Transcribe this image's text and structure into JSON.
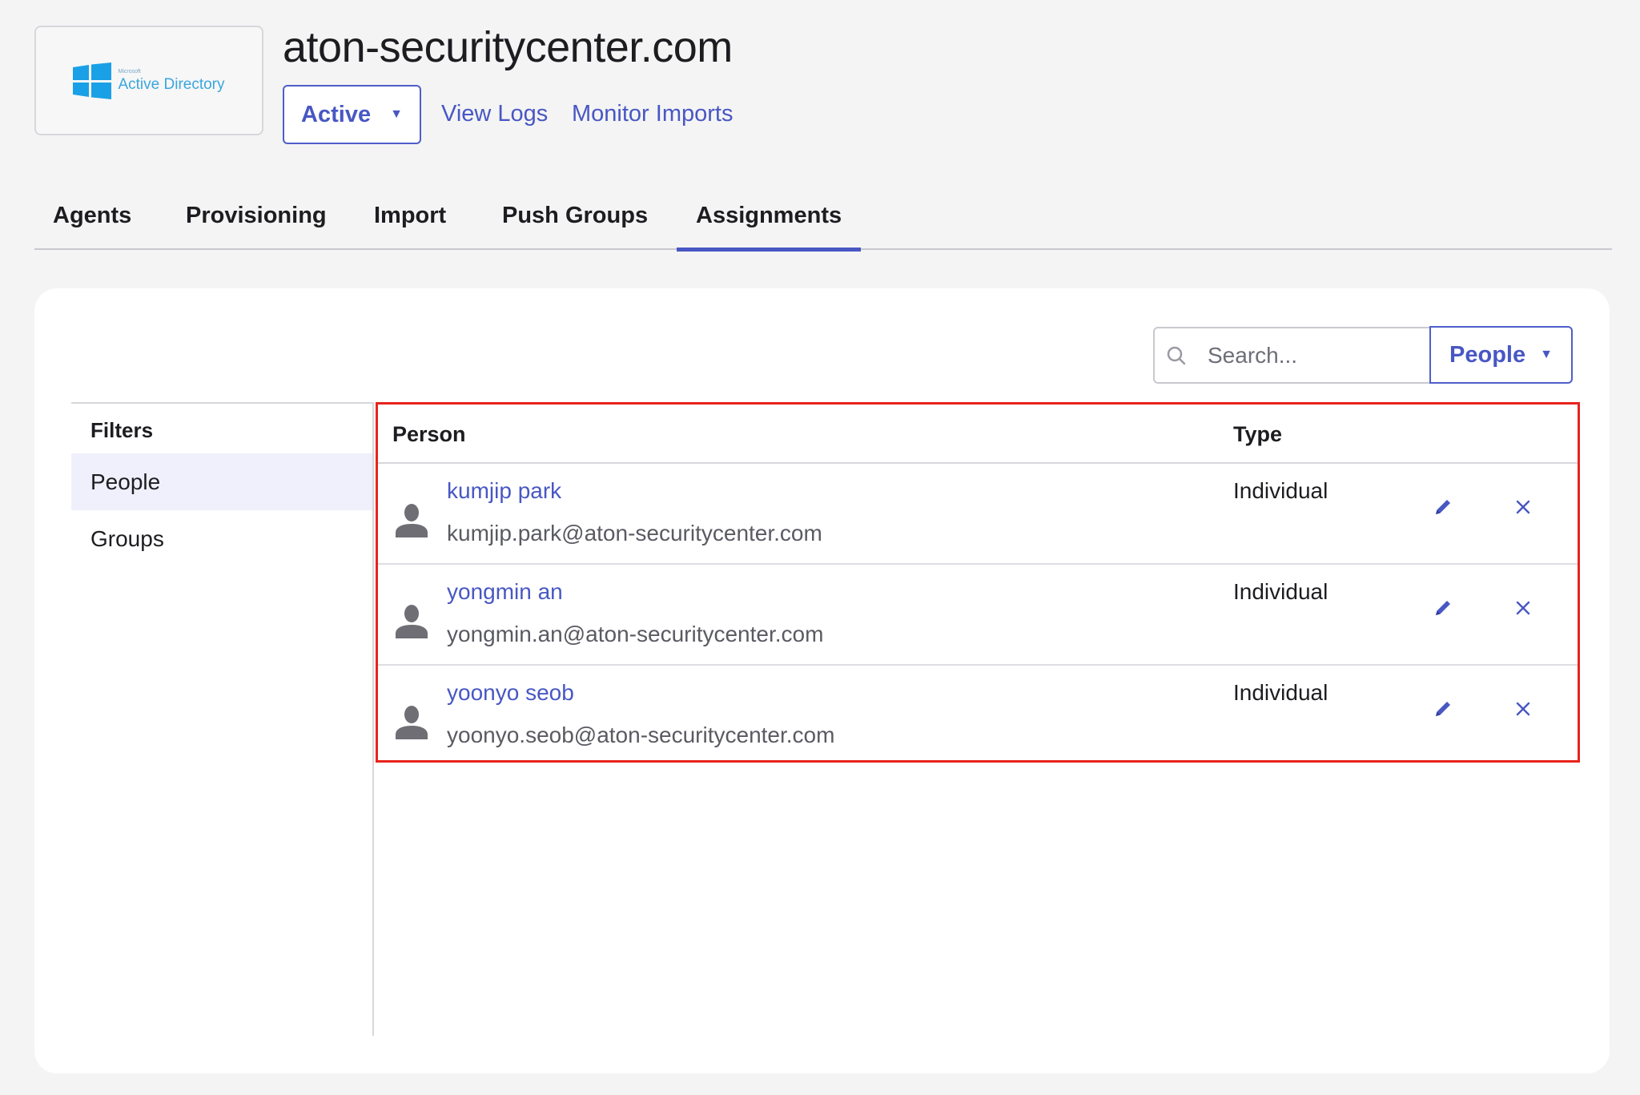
{
  "header": {
    "logo": {
      "small_text": "Microsoft",
      "name": "Active Directory",
      "icon": "windows-logo-icon"
    },
    "title": "aton-securitycenter.com",
    "status_label": "Active",
    "links": {
      "view_logs": "View Logs",
      "monitor_imports": "Monitor Imports"
    }
  },
  "tabs": [
    {
      "label": "Agents",
      "active": false
    },
    {
      "label": "Provisioning",
      "active": false
    },
    {
      "label": "Import",
      "active": false
    },
    {
      "label": "Push Groups",
      "active": false
    },
    {
      "label": "Assignments",
      "active": true
    }
  ],
  "toolbar": {
    "search_placeholder": "Search...",
    "search_value": "",
    "type_dropdown": "People"
  },
  "filters": {
    "title": "Filters",
    "items": [
      {
        "label": "People",
        "selected": true
      },
      {
        "label": "Groups",
        "selected": false
      }
    ]
  },
  "table": {
    "columns": {
      "person": "Person",
      "type": "Type"
    },
    "rows": [
      {
        "name": "kumjip park",
        "email": "kumjip.park@aton-securitycenter.com",
        "type": "Individual"
      },
      {
        "name": "yongmin an",
        "email": "yongmin.an@aton-securitycenter.com",
        "type": "Individual"
      },
      {
        "name": "yoonyo seob",
        "email": "yoonyo.seob@aton-securitycenter.com",
        "type": "Individual"
      }
    ]
  },
  "colors": {
    "accent": "#4857c3",
    "highlight_border": "#e8231d",
    "selected_filter_bg": "#eff0fb",
    "page_bg": "#f4f4f4"
  }
}
